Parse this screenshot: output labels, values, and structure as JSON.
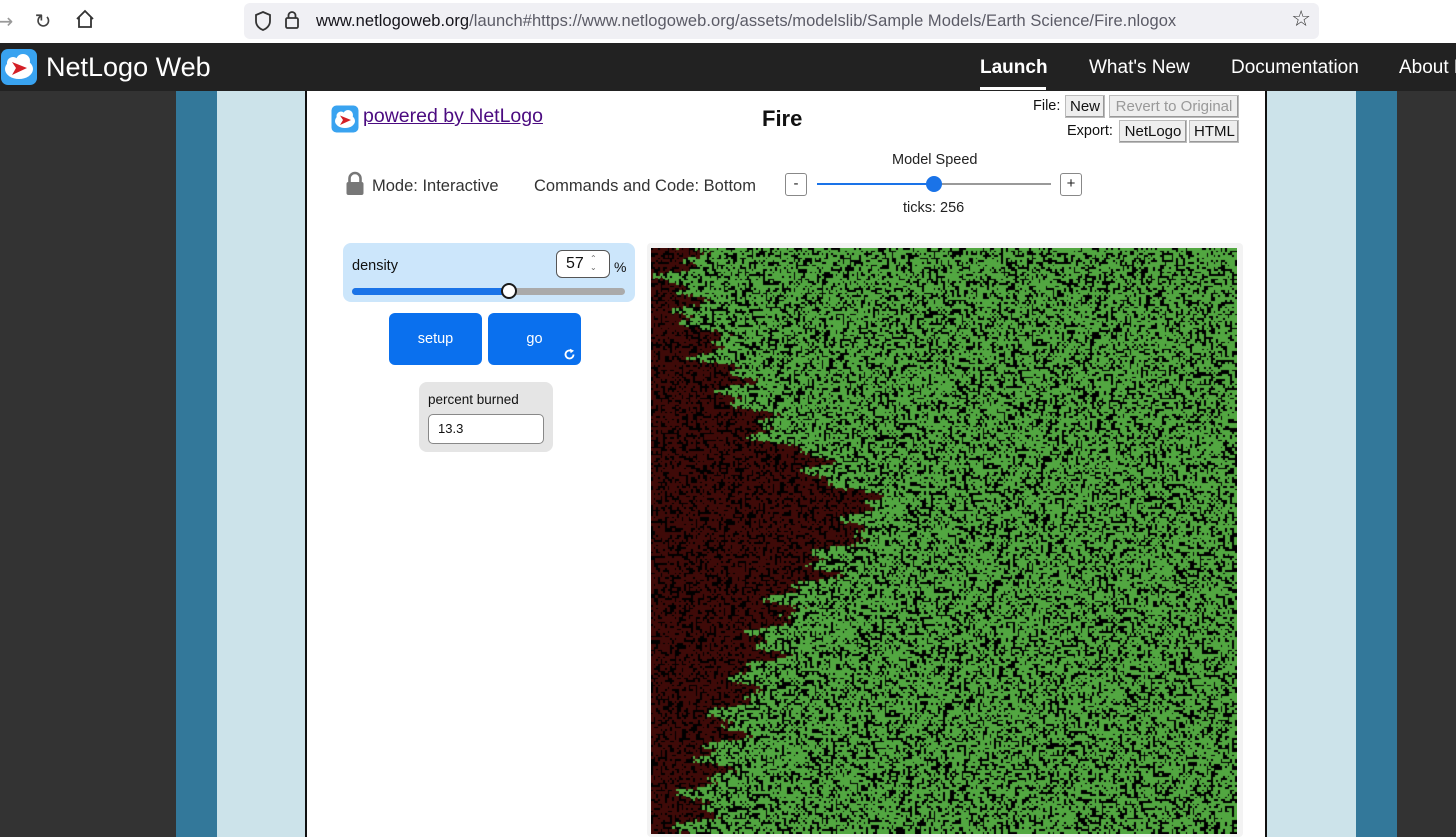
{
  "browser": {
    "url_host": "www.netlogoweb.org",
    "url_rest": "/launch#https://www.netlogoweb.org/assets/modelslib/Sample Models/Earth Science/Fire.nlogox",
    "icons": [
      "forward-icon",
      "reload-icon",
      "home-icon",
      "shield-icon",
      "lock-icon",
      "bookmark-star-icon"
    ]
  },
  "header": {
    "title": "NetLogo Web",
    "nav": {
      "launch": "Launch",
      "whats_new": "What's New",
      "documentation": "Documentation",
      "about": "About NetLogo"
    }
  },
  "model": {
    "powered_by": " powered by NetLogo",
    "title": "Fire",
    "file_label": "File:",
    "export_label": "Export:",
    "new_button": "New",
    "revert_button": "Revert to Original",
    "export_netlogo": "NetLogo",
    "export_html": "HTML",
    "mode": "Mode: Interactive",
    "commands_and_code": "Commands and Code: Bottom",
    "speed_label": "Model Speed",
    "speed_minus": "-",
    "speed_plus": "+",
    "ticks": "ticks: 256"
  },
  "widgets": {
    "density": {
      "label": "density",
      "value": "57",
      "units": "%",
      "min": 0,
      "max": 99
    },
    "setup": {
      "label": "setup"
    },
    "go": {
      "label": "go",
      "forever": true
    },
    "percent_burned": {
      "label": "percent burned",
      "value": "13.3"
    }
  },
  "colors": {
    "tree": "#52a741",
    "ember": "#3f0a08",
    "empty": "#000000",
    "accent": "#0a70ee",
    "header_bg": "#222222",
    "band_dark": "#33789a",
    "band_light": "#cce3ea"
  }
}
